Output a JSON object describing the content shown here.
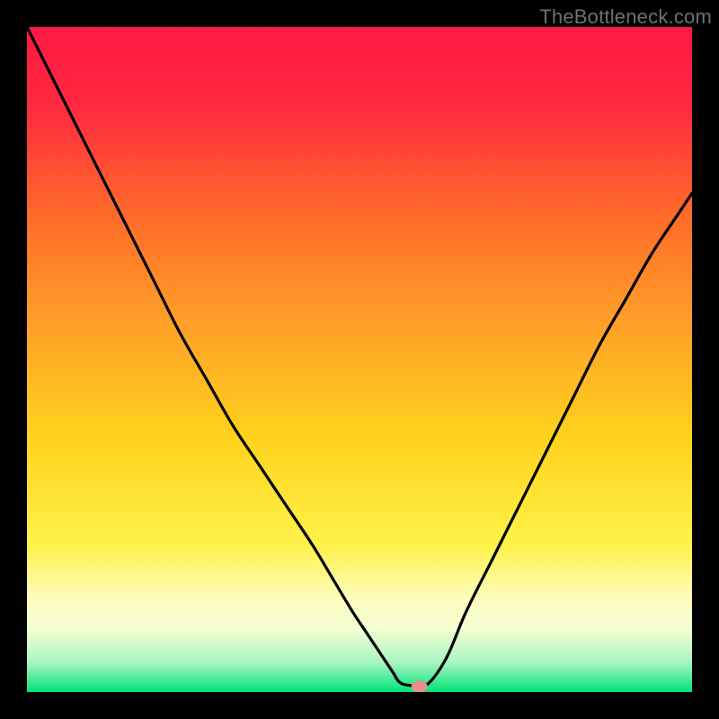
{
  "watermark": "TheBottleneck.com",
  "chart_data": {
    "type": "line",
    "title": "",
    "xlabel": "",
    "ylabel": "",
    "xlim": [
      0,
      100
    ],
    "ylim": [
      0,
      100
    ],
    "background_gradient": {
      "stops": [
        {
          "pos": 0.0,
          "color": "#ff1744"
        },
        {
          "pos": 0.12,
          "color": "#ff2a3f"
        },
        {
          "pos": 0.28,
          "color": "#ff6a2a"
        },
        {
          "pos": 0.45,
          "color": "#ffa127"
        },
        {
          "pos": 0.62,
          "color": "#ffd31c"
        },
        {
          "pos": 0.78,
          "color": "#fff24a"
        },
        {
          "pos": 0.86,
          "color": "#fffcbf"
        },
        {
          "pos": 0.905,
          "color": "#f3ffd2"
        },
        {
          "pos": 0.955,
          "color": "#a9f5c3"
        },
        {
          "pos": 1.0,
          "color": "#00e47a"
        }
      ]
    },
    "series": [
      {
        "name": "bottleneck-curve",
        "x": [
          0,
          3,
          7,
          11,
          15,
          19,
          23,
          27,
          31,
          35,
          39,
          43,
          46,
          49,
          51,
          53,
          55,
          56,
          57.5,
          60,
          63,
          66,
          70,
          74,
          78,
          82,
          86,
          90,
          94,
          98,
          100
        ],
        "y": [
          100,
          94,
          86,
          78,
          70,
          62,
          54,
          47,
          40,
          34,
          28,
          22,
          17,
          12,
          9,
          6,
          3,
          1.5,
          1,
          1,
          5,
          12,
          20,
          28,
          36,
          44,
          52,
          59,
          66,
          72,
          75
        ]
      }
    ],
    "marker": {
      "x": 59,
      "y": 0.8,
      "color": "#e4918a"
    }
  }
}
